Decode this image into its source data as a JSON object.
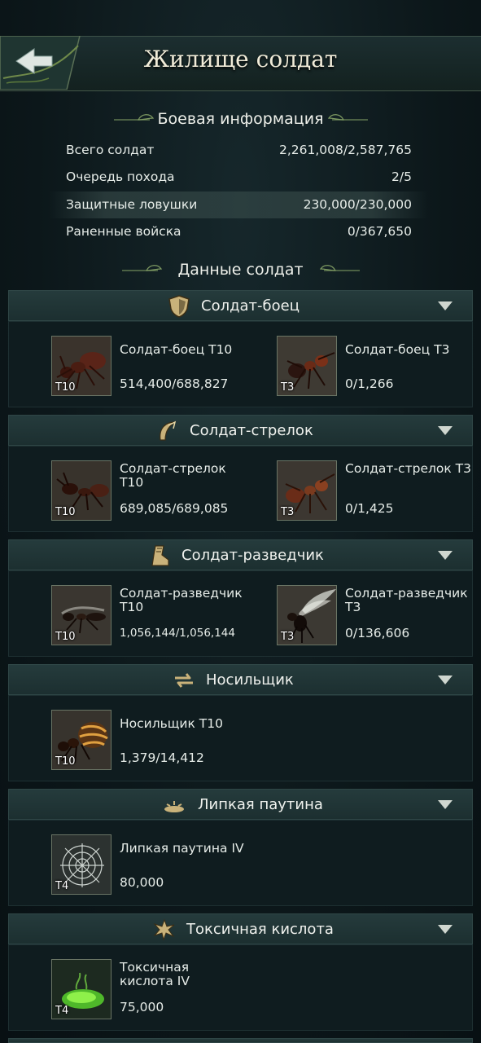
{
  "header": {
    "title": "Жилище солдат"
  },
  "battle_info": {
    "title": "Боевая информация",
    "rows": [
      {
        "label": "Всего солдат",
        "value": "2,261,008/2,587,765"
      },
      {
        "label": "Очередь похода",
        "value": "2/5"
      },
      {
        "label": "Защитные ловушки",
        "value": "230,000/230,000"
      },
      {
        "label": "Раненные войска",
        "value": "0/367,650"
      }
    ]
  },
  "soldier_data": {
    "title": "Данные солдат"
  },
  "categories": [
    {
      "label": "Солдат-боец",
      "icon": "shield-icon",
      "units": [
        {
          "name": "Солдат-боец T10",
          "count": "514,400/688,827",
          "tier": "T10"
        },
        {
          "name": "Солдат-боец T3",
          "count": "0/1,266",
          "tier": "T3"
        }
      ]
    },
    {
      "label": "Солдат-стрелок",
      "icon": "bow-icon",
      "units": [
        {
          "name": "Солдат-стрелок T10",
          "count": "689,085/689,085",
          "tier": "T10"
        },
        {
          "name": "Солдат-стрелок T3",
          "count": "0/1,425",
          "tier": "T3"
        }
      ]
    },
    {
      "label": "Солдат-разведчик",
      "icon": "boot-icon",
      "units": [
        {
          "name": "Солдат-разведчик T10",
          "count": "1,056,144/1,056,144",
          "tier": "T10"
        },
        {
          "name": "Солдат-разведчик T3",
          "count": "0/136,606",
          "tier": "T3"
        }
      ]
    },
    {
      "label": "Носильщик",
      "icon": "speed-arrows-icon",
      "units": [
        {
          "name": "Носильщик T10",
          "count": "1,379/14,412",
          "tier": "T10"
        }
      ]
    },
    {
      "label": "Липкая паутина",
      "icon": "web-trap-icon",
      "units": [
        {
          "name": "Липкая паутина IV",
          "count": "80,000",
          "tier": "T4"
        }
      ]
    },
    {
      "label": "Токсичная кислота",
      "icon": "acid-splash-icon",
      "units": [
        {
          "name": "Токсичная кислота IV",
          "count": "75,000",
          "tier": "T4"
        }
      ]
    }
  ],
  "colors": {
    "accent": "#cfd6cf",
    "panel": "#1c2f30",
    "background": "#0b1518"
  }
}
